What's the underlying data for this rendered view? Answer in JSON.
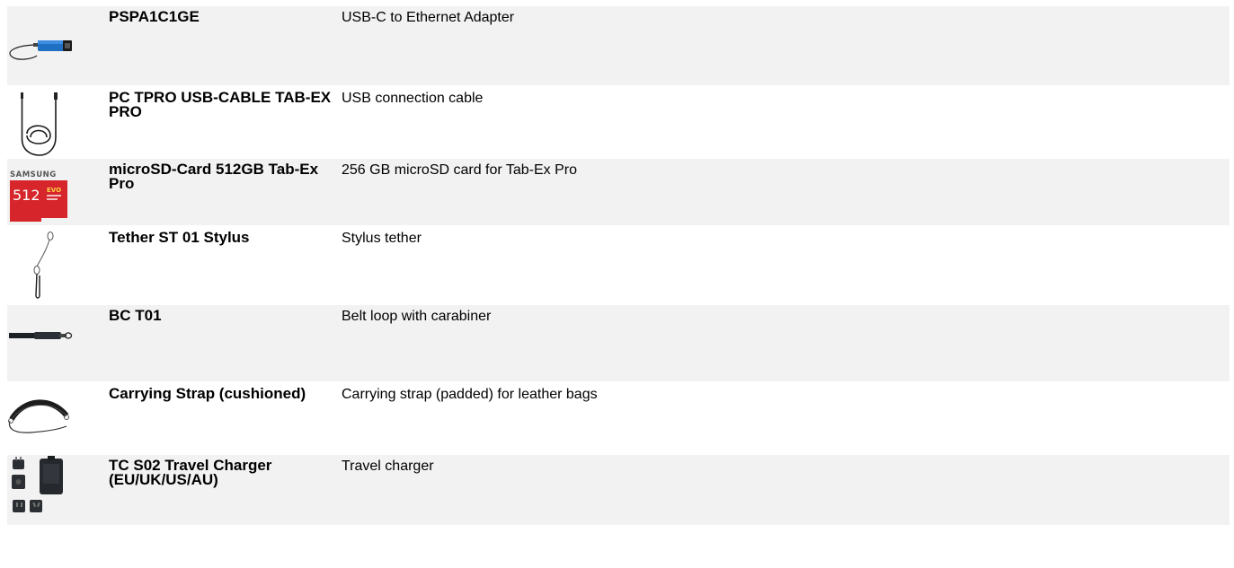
{
  "rows": [
    {
      "code": "PSPA1C1GE",
      "description": "USB-C to Ethernet Adapter",
      "icon": "usb-ethernet-adapter-icon"
    },
    {
      "code": "PC TPRO USB-CABLE TAB-EX PRO",
      "description": "USB connection cable",
      "icon": "usb-cable-icon"
    },
    {
      "code": "microSD-Card 512GB Tab-Ex Pro",
      "description": "256 GB microSD card for Tab-Ex Pro",
      "icon": "microsd-card-icon",
      "card_brand": "SAMSUNG",
      "card_capacity": "512",
      "card_line": "EVO"
    },
    {
      "code": "Tether ST 01 Stylus",
      "description": "Stylus tether",
      "icon": "stylus-tether-icon"
    },
    {
      "code": "BC T01",
      "description": "Belt loop with carabiner",
      "icon": "belt-loop-icon"
    },
    {
      "code": "Carrying Strap (cushioned)",
      "description": "Carrying strap (padded) for leather bags",
      "icon": "carrying-strap-icon"
    },
    {
      "code": "TC S02 Travel Charger (EU/UK/US/AU)",
      "description": "Travel charger",
      "icon": "travel-charger-icon"
    }
  ],
  "colors": {
    "row_alt": "#f2f2f2",
    "adapter_blue": "#1f6fc2",
    "card_red": "#d7262b"
  }
}
